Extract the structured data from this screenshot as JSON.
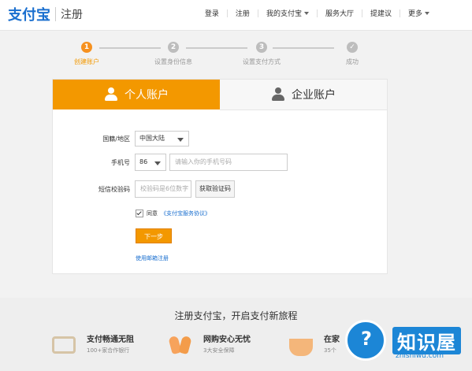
{
  "header": {
    "logo": "支付宝",
    "subtitle": "注册",
    "nav": [
      "登录",
      "注册",
      "我的支付宝",
      "服务大厅",
      "提建议",
      "更多"
    ]
  },
  "steps": [
    {
      "num": "1",
      "label": "创建账户"
    },
    {
      "num": "2",
      "label": "设置身份信息"
    },
    {
      "num": "3",
      "label": "设置支付方式"
    },
    {
      "num": "",
      "label": "成功"
    }
  ],
  "tabs": {
    "personal": "个人账户",
    "business": "企业账户"
  },
  "form": {
    "region_label": "国籍/地区",
    "region_value": "中国大陆",
    "phone_label": "手机号",
    "country_code": "86",
    "phone_placeholder": "请输入你的手机号码",
    "sms_label": "短信校验码",
    "sms_placeholder": "校验码是6位数字",
    "get_code": "获取验证码",
    "agree_prefix": "同意",
    "agree_link": "《支付宝服务协议》",
    "next": "下一步",
    "email_link": "使用邮箱注册"
  },
  "bottom": {
    "tagline": "注册支付宝，开启支付新旅程",
    "features": [
      {
        "title": "支付畅通无阻",
        "sub": "100+家合作银行"
      },
      {
        "title": "网购安心无忧",
        "sub": "3大安全保障"
      },
      {
        "title": "在家",
        "sub": "35个"
      }
    ]
  },
  "watermark": {
    "mark": "?",
    "text": "知识屋",
    "url": "zhishiwu.com"
  },
  "colors": {
    "accent": "#f39800",
    "link": "#1a6fcf"
  }
}
